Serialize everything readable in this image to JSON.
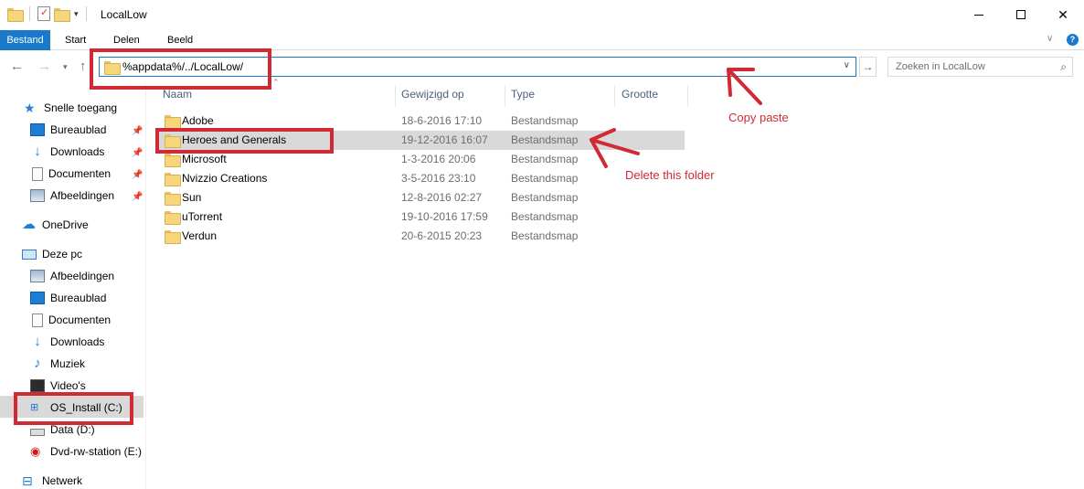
{
  "window": {
    "title": "LocalLow",
    "minimize_label": "Minimize",
    "maximize_label": "Maximize",
    "close_label": "Close"
  },
  "ribbon": {
    "tabs": [
      "Bestand",
      "Start",
      "Delen",
      "Beeld"
    ]
  },
  "address_bar": {
    "value": "%appdata%/../LocalLow/"
  },
  "search": {
    "placeholder": "Zoeken in LocalLow"
  },
  "navigation_pane": {
    "quick_access": "Snelle toegang",
    "quick_items": [
      "Bureaublad",
      "Downloads",
      "Documenten",
      "Afbeeldingen"
    ],
    "onedrive": "OneDrive",
    "this_pc": "Deze pc",
    "pc_items": [
      "Afbeeldingen",
      "Bureaublad",
      "Documenten",
      "Downloads",
      "Muziek",
      "Video's",
      "OS_Install (C:)",
      "Data (D:)",
      "Dvd-rw-station (E:)"
    ],
    "network": "Netwerk",
    "selected": "OS_Install (C:)"
  },
  "file_list": {
    "columns": [
      "Naam",
      "Gewijzigd op",
      "Type",
      "Grootte"
    ],
    "rows": [
      {
        "name": "Adobe",
        "modified": "18-6-2016 17:10",
        "type": "Bestandsmap"
      },
      {
        "name": "Heroes and Generals",
        "modified": "19-12-2016 16:07",
        "type": "Bestandsmap"
      },
      {
        "name": "Microsoft",
        "modified": "1-3-2016 20:06",
        "type": "Bestandsmap"
      },
      {
        "name": "Nvizzio Creations",
        "modified": "3-5-2016 23:10",
        "type": "Bestandsmap"
      },
      {
        "name": "Sun",
        "modified": "12-8-2016 02:27",
        "type": "Bestandsmap"
      },
      {
        "name": "uTorrent",
        "modified": "19-10-2016 17:59",
        "type": "Bestandsmap"
      },
      {
        "name": "Verdun",
        "modified": "20-6-2015 20:23",
        "type": "Bestandsmap"
      }
    ],
    "highlighted_row": "Heroes and Generals"
  },
  "annotations": {
    "copy_note": "Copy paste",
    "delete_note": "Delete this folder",
    "color": "#d22a35"
  },
  "colors": {
    "accent": "#1979ca",
    "selection": "#d9d9d9",
    "header_text": "#4c607a"
  }
}
